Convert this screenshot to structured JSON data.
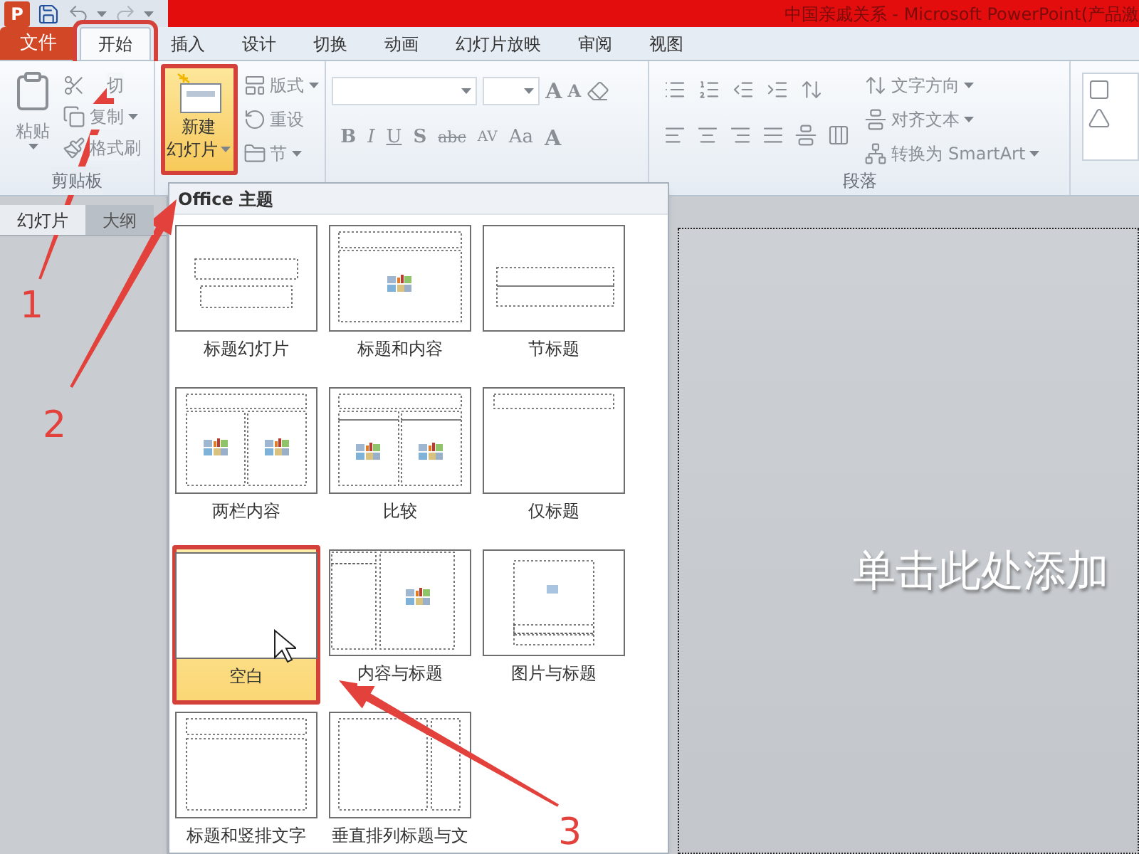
{
  "title_bar": {
    "app_icon": "P",
    "title": "中国亲戚关系 - Microsoft PowerPoint(产品激"
  },
  "tabs": [
    {
      "label": "文件",
      "kind": "file",
      "selected": false,
      "highlight": false
    },
    {
      "label": "开始",
      "kind": "tab",
      "selected": true,
      "highlight": true
    },
    {
      "label": "插入",
      "kind": "tab",
      "selected": false,
      "highlight": false
    },
    {
      "label": "设计",
      "kind": "tab",
      "selected": false,
      "highlight": false
    },
    {
      "label": "切换",
      "kind": "tab",
      "selected": false,
      "highlight": false
    },
    {
      "label": "动画",
      "kind": "tab",
      "selected": false,
      "highlight": false
    },
    {
      "label": "幻灯片放映",
      "kind": "tab",
      "selected": false,
      "highlight": false
    },
    {
      "label": "审阅",
      "kind": "tab",
      "selected": false,
      "highlight": false
    },
    {
      "label": "视图",
      "kind": "tab",
      "selected": false,
      "highlight": false
    }
  ],
  "clipboard": {
    "paste": "粘贴",
    "cut": "切",
    "copy": "复制",
    "format_painter": "格式刷",
    "label": "剪贴板"
  },
  "slides_group": {
    "new_slide": {
      "line1": "新建",
      "line2": "幻灯片",
      "highlight": true
    },
    "layout": "版式",
    "reset": "重设",
    "section": "节"
  },
  "font_group": {
    "bold": "B",
    "italic": "I",
    "underline": "U",
    "shadow": "S",
    "strike": "abc",
    "spacing": "AV",
    "case": "Aa",
    "grow": "A",
    "shrink": "A",
    "font_color": "A"
  },
  "paragraph_group": {
    "text_direction": "文字方向",
    "align_text": "对齐文本",
    "smartart": "转换为 SmartArt",
    "label": "段落"
  },
  "slides_pane": {
    "tabs": [
      {
        "label": "幻灯片",
        "selected": true
      },
      {
        "label": "大纲",
        "selected": false
      }
    ]
  },
  "slide": {
    "placeholder": "单击此处添加"
  },
  "layout_menu": {
    "header": "Office 主题",
    "layouts": [
      {
        "name": "标题幻灯片",
        "kind": "title",
        "selected": false,
        "highlight": false
      },
      {
        "name": "标题和内容",
        "kind": "title_content",
        "selected": false,
        "highlight": false
      },
      {
        "name": "节标题",
        "kind": "section",
        "selected": false,
        "highlight": false
      },
      {
        "name": "两栏内容",
        "kind": "two_content",
        "selected": false,
        "highlight": false
      },
      {
        "name": "比较",
        "kind": "comparison",
        "selected": false,
        "highlight": false
      },
      {
        "name": "仅标题",
        "kind": "title_only",
        "selected": false,
        "highlight": false
      },
      {
        "name": "空白",
        "kind": "blank",
        "selected": true,
        "highlight": true
      },
      {
        "name": "内容与标题",
        "kind": "content_caption",
        "selected": false,
        "highlight": false
      },
      {
        "name": "图片与标题",
        "kind": "picture_caption",
        "selected": false,
        "highlight": false
      },
      {
        "name": "标题和竖排文字",
        "kind": "vertical_text",
        "selected": false,
        "highlight": false
      },
      {
        "name": "垂直排列标题与文",
        "kind": "vertical_title",
        "selected": false,
        "highlight": false
      }
    ]
  },
  "annotations": [
    {
      "label": "1"
    },
    {
      "label": "2"
    },
    {
      "label": "3"
    }
  ]
}
